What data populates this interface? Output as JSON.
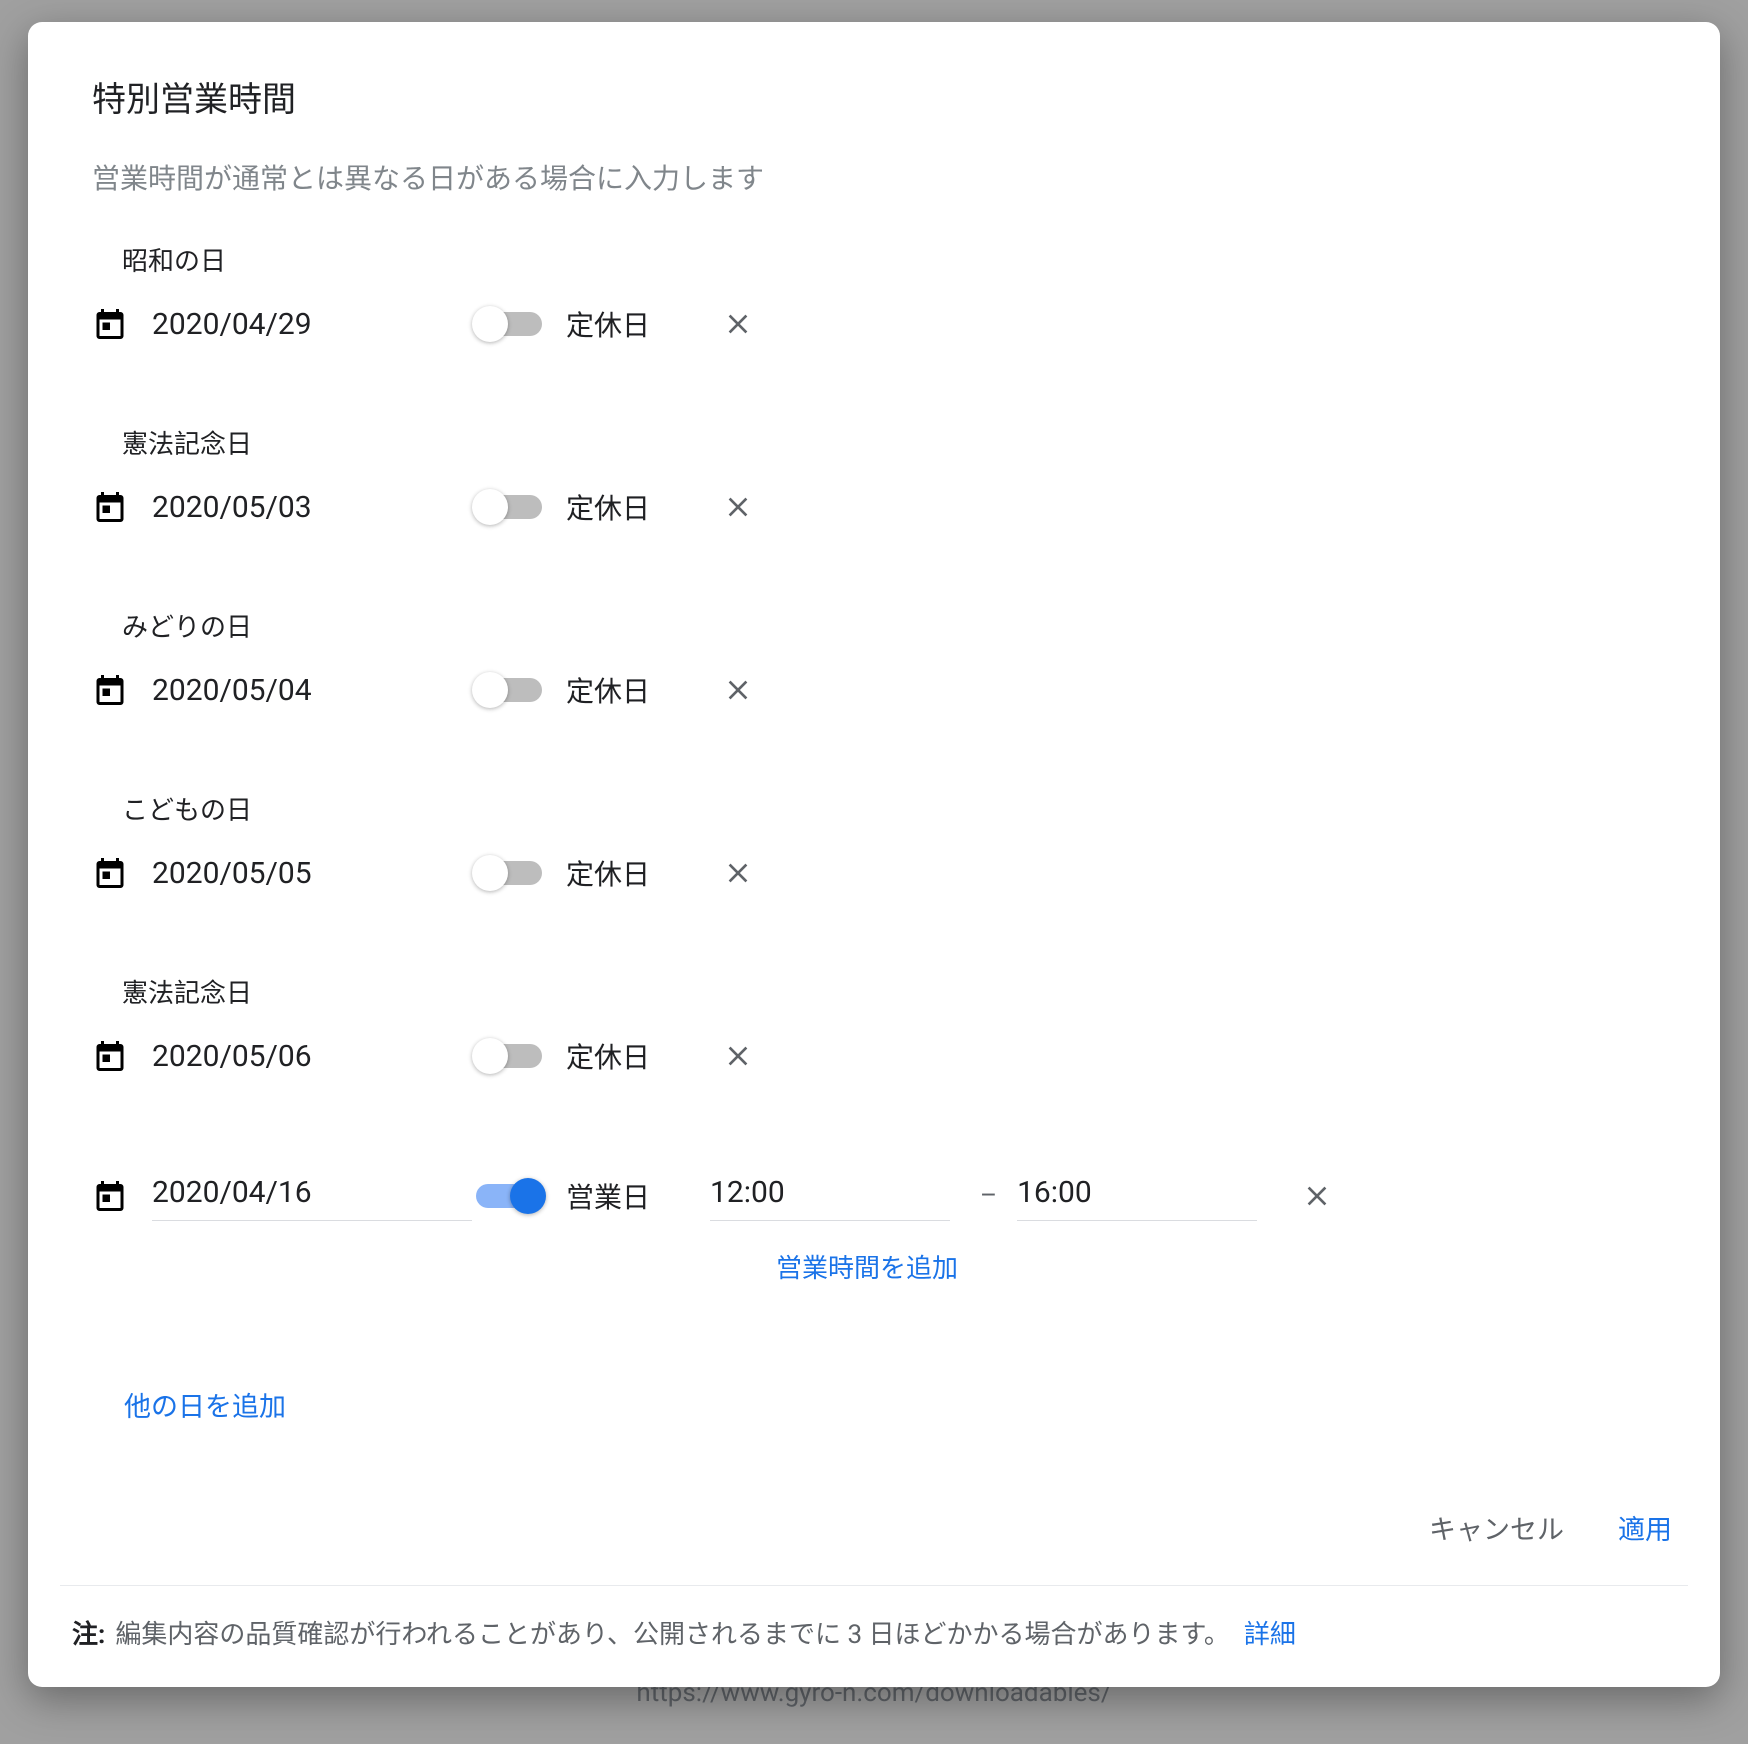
{
  "dialog": {
    "title": "特別営業時間",
    "subtitle": "営業時間が通常とは異なる日がある場合に入力します",
    "holidays": [
      {
        "name": "昭和の日",
        "date": "2020/04/29",
        "closed": true,
        "label": "定休日"
      },
      {
        "name": "憲法記念日",
        "date": "2020/05/03",
        "closed": true,
        "label": "定休日"
      },
      {
        "name": "みどりの日",
        "date": "2020/05/04",
        "closed": true,
        "label": "定休日"
      },
      {
        "name": "こどもの日",
        "date": "2020/05/05",
        "closed": true,
        "label": "定休日"
      },
      {
        "name": "憲法記念日",
        "date": "2020/05/06",
        "closed": true,
        "label": "定休日"
      }
    ],
    "custom": {
      "date": "2020/04/16",
      "closed": false,
      "label": "営業日",
      "open_time": "12:00",
      "close_time": "16:00",
      "sep": "–"
    },
    "add_hours": "営業時間を追加",
    "add_day": "他の日を追加",
    "cancel": "キャンセル",
    "apply": "適用",
    "note_label": "注:",
    "note_text": "編集内容の品質確認が行われることがあり、公開されるまでに 3 日ほどかかる場合があります。",
    "note_link": "詳細"
  },
  "background": {
    "url": "https://www.gyro-n.com/downloadables/"
  }
}
